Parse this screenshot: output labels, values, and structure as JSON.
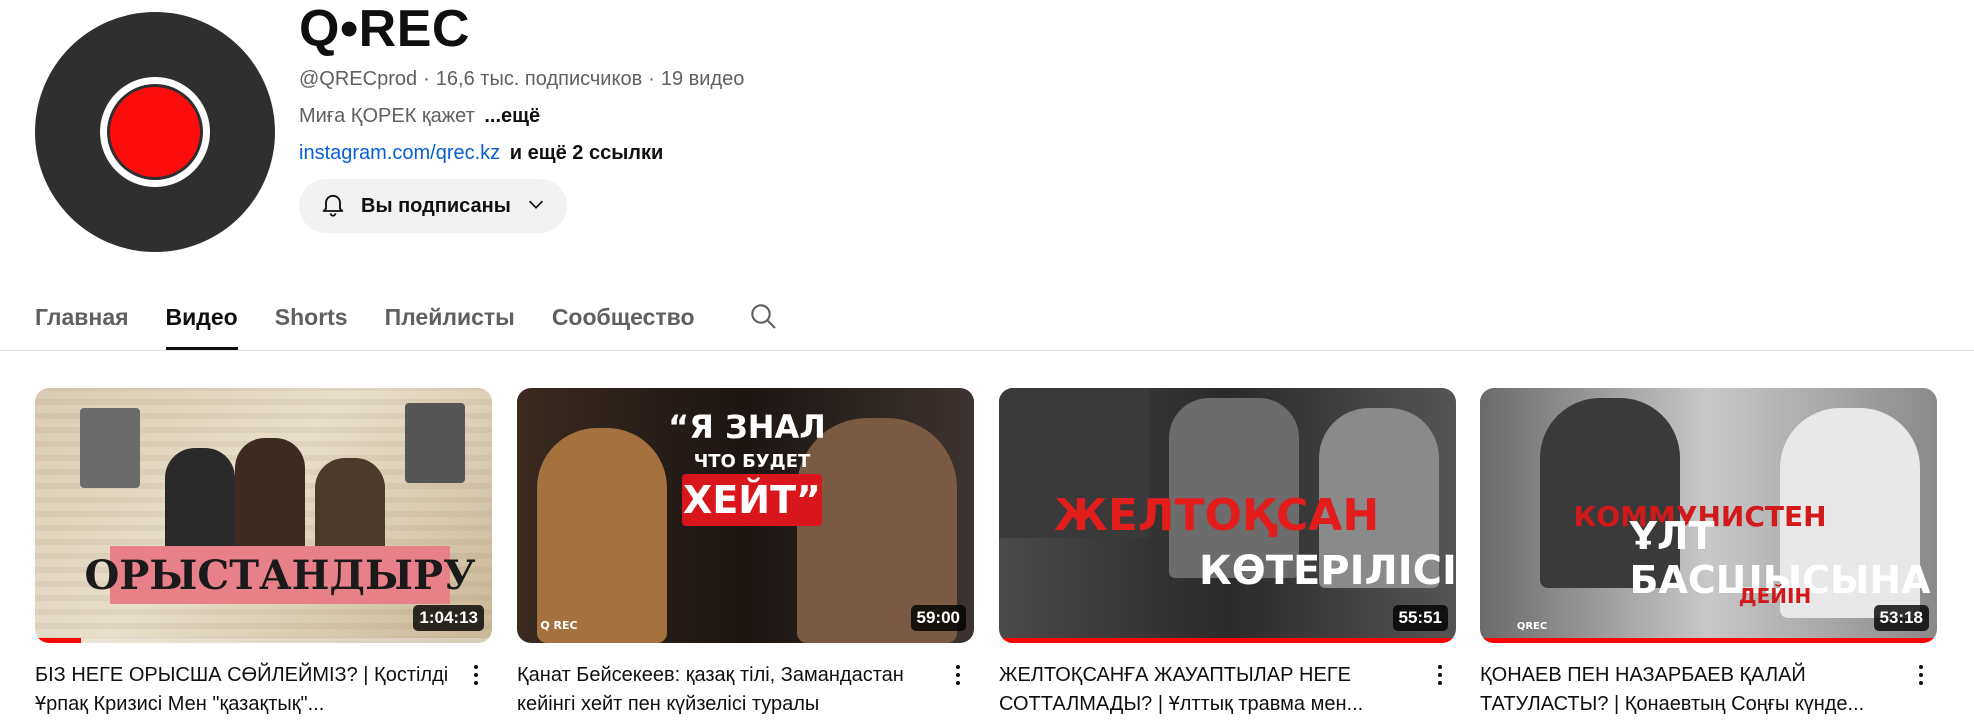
{
  "channel": {
    "name": "Q•REC",
    "handle": "@QRECprod",
    "subscribers": "16,6 тыс. подписчиков",
    "videos_count": "19 видео",
    "separator": "·",
    "description": "Миға ҚОРЕК қажет",
    "description_more": "...ещё",
    "link": "instagram.com/qrec.kz",
    "links_more": "и ещё 2 ссылки",
    "subscribe_label": "Вы подписаны"
  },
  "tabs": [
    {
      "label": "Главная",
      "active": false
    },
    {
      "label": "Видео",
      "active": true
    },
    {
      "label": "Shorts",
      "active": false
    },
    {
      "label": "Плейлисты",
      "active": false
    },
    {
      "label": "Сообщество",
      "active": false
    }
  ],
  "videos": [
    {
      "title": "БІЗ НЕГЕ ОРЫСША СӨЙЛЕЙМІЗ? | Қостілді Ұрпақ Кризисі Мен \"қазақтық\"...",
      "duration": "1:04:13",
      "watched_fraction": 0.1,
      "thumb_text": "ОРЫСТАНДЫРУ"
    },
    {
      "title": "Қанат Бейсекеев: қазақ тілі, Замандастан кейінгі хейт пен күйзелісі туралы",
      "duration": "59:00",
      "watched_fraction": 0.0,
      "thumb_text_1": "“Я ЗНАЛ",
      "thumb_text_2": "ЧТО БУДЕТ",
      "thumb_text_3": "ХЕЙТ”",
      "thumb_logo": "Q REC"
    },
    {
      "title": "ЖЕЛТОҚСАНҒА ЖАУАПТЫЛАР НЕГЕ СОТТАЛМАДЫ? | Ұлттық травма мен...",
      "duration": "55:51",
      "watched_fraction": 1.0,
      "thumb_text_1": "ЖЕЛТОҚСАН",
      "thumb_text_2": "КӨТЕРІЛІСІ"
    },
    {
      "title": "ҚОНАЕВ ПЕН НАЗАРБАЕВ ҚАЛАЙ ТАТУЛАСТЫ? | Қонаевтың Соңғы күнде...",
      "duration": "53:18",
      "watched_fraction": 1.0,
      "thumb_text_1": "КОММУНИСТЕН",
      "thumb_text_2": "ҰЛТ БАСШЫСЫНА",
      "thumb_text_3": "ДЕЙІН",
      "thumb_logo": "QREC"
    }
  ],
  "colors": {
    "accent_red": "#ff0000",
    "link_blue": "#065fd4",
    "secondary_text": "#606060"
  }
}
